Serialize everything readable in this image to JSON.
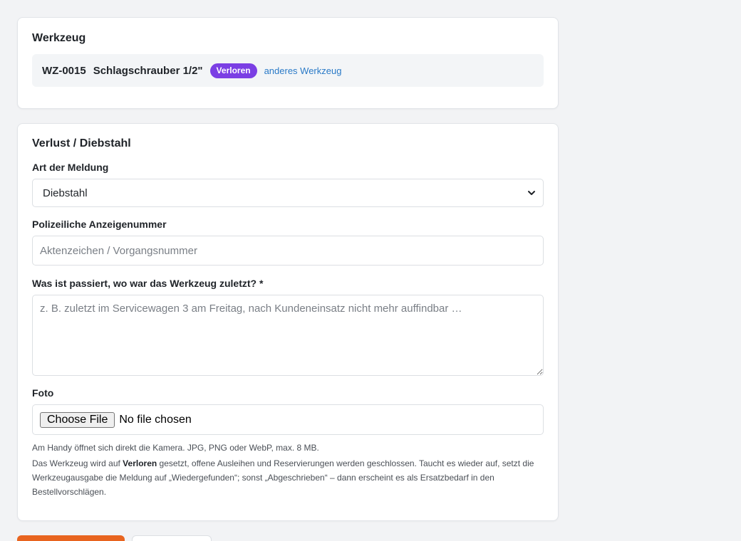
{
  "tool_card": {
    "title": "Werkzeug",
    "code": "WZ-0015",
    "name": "Schlagschrauber 1/2\"",
    "status_badge": "Verloren",
    "change_link": "anderes Werkzeug"
  },
  "form_card": {
    "title": "Verlust / Diebstahl",
    "report_type": {
      "label": "Art der Meldung",
      "selected": "Diebstahl"
    },
    "police_number": {
      "label": "Polizeiliche Anzeigenummer",
      "placeholder": "Aktenzeichen / Vorgangsnummer",
      "value": ""
    },
    "description": {
      "label": "Was ist passiert, wo war das Werkzeug zuletzt? *",
      "placeholder": "z. B. zuletzt im Servicewagen 3 am Freitag, nach Kundeneinsatz nicht mehr auffindbar …",
      "value": ""
    },
    "photo": {
      "label": "Foto",
      "button_label": "Choose File",
      "status": "No file chosen"
    },
    "hint_camera": "Am Handy öffnet sich direkt die Kamera. JPG, PNG oder WebP, max. 8 MB.",
    "info": {
      "part1": "Das Werkzeug wird auf ",
      "bold": "Verloren",
      "part2": " gesetzt, offene Ausleihen und Reservierungen werden geschlossen. Taucht es wieder auf, setzt die Werkzeugausgabe die Meldung auf „Wiedergefunden“; sonst „Abgeschrieben“ – dann erscheint es als Ersatzbedarf in den Bestellvorschlägen."
    }
  },
  "colors": {
    "accent": "#e8641f",
    "badge": "#7b3fe4",
    "link": "#2a7ac7",
    "background": "#f2f3f5"
  }
}
